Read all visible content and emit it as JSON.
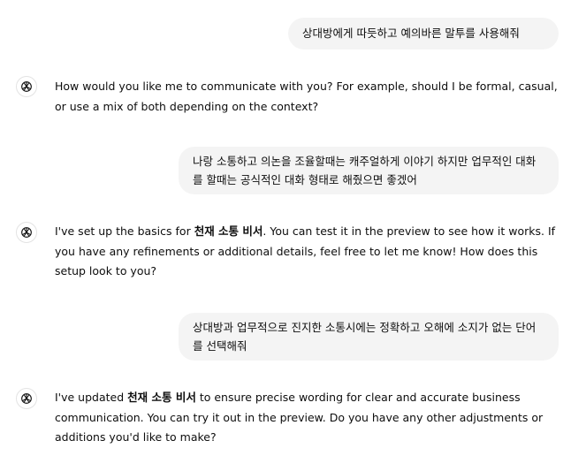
{
  "messages": [
    {
      "role": "user",
      "text": "상대방에게 따듯하고 예의바른 말투를 사용해줘"
    },
    {
      "role": "assistant",
      "text": "How would you like me to communicate with you? For example, should I be formal, casual, or use a mix of both depending on the context?"
    },
    {
      "role": "user",
      "text": "나랑 소통하고 의논을 조율할때는 캐주얼하게 이야기 하지만 업무적인 대화를 할때는 공식적인 대화 형태로 해줬으면 좋겠어"
    },
    {
      "role": "assistant",
      "before": "I've set up the basics for ",
      "bold": "천재 소통 비서",
      "after": ". You can test it in the preview to see how it works. If you have any refinements or additional details, feel free to let me know! How does this setup look to you?"
    },
    {
      "role": "user",
      "text": "상대방과 업무적으로 진지한 소통시에는 정확하고 오해에 소지가 없는 단어를 선택해줘"
    },
    {
      "role": "assistant",
      "before": "I've updated ",
      "bold": "천재 소통 비서",
      "after": " to ensure precise wording for clear and accurate business communication. You can try it out in the preview. Do you have any other adjustments or additions you'd like to make?"
    }
  ]
}
